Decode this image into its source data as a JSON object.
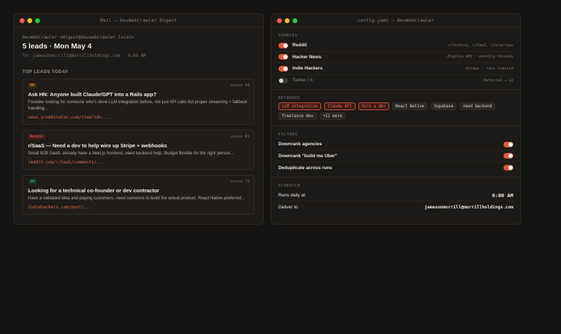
{
  "mail": {
    "window_title": "Mail — DevWebCrawler Digest",
    "from": "DevWebCrawler <digest@devwebcrawler.local>",
    "subject": "5 leads · Mon May 4",
    "to": "To: jamesonmorrill@morrillholdings.com · 6:00 AM",
    "section_label": "TOP LEADS TODAY",
    "leads": [
      {
        "tag": "HN",
        "score": "score 94",
        "title": "Ask HN: Anyone built Claude/GPT into a Rails app?",
        "snippet": "Founder looking for someone who's done LLM integration before, not just API calls but proper streaming + fallback handling...",
        "link": "news.ycombinator.com/item?id=..."
      },
      {
        "tag": "Reddit",
        "score": "score 81",
        "title": "r/SaaS — Need a dev to help wire up Stripe + webhooks",
        "snippet": "Small B2B SaaS, already have a Next.js frontend, need backend help. Budget flexible for the right person...",
        "link": "reddit.com/r/SaaS/comments/..."
      },
      {
        "tag": "IH",
        "score": "score 72",
        "title": "Looking for a technical co-founder or dev contractor",
        "snippet": "Have a validated idea and paying customers, need someone to build the actual product. React Native preferred...",
        "link": "indiehackers.com/post/..."
      }
    ]
  },
  "config": {
    "window_title": "config.yaml — DevWebCrawler",
    "sources_label": "SOURCES",
    "sources": [
      {
        "name": "Reddit",
        "detail": "r/forhire, r/SaaS, r/startups",
        "enabled": true
      },
      {
        "name": "Hacker News",
        "detail": "Algolia API · monthly threads",
        "enabled": true
      },
      {
        "name": "Indie Hackers",
        "detail": "Scrape · rate limited",
        "enabled": true
      },
      {
        "name": "Twitter / X",
        "detail": "Deferred → v2",
        "enabled": false
      }
    ],
    "keywords_label": "KEYWORDS",
    "keywords": [
      {
        "text": "LLM integration",
        "hot": true
      },
      {
        "text": "Claude API",
        "hot": true
      },
      {
        "text": "hire a dev",
        "hot": true
      },
      {
        "text": "React Native",
        "hot": false
      },
      {
        "text": "Supabase",
        "hot": false
      },
      {
        "text": "need backend",
        "hot": false
      },
      {
        "text": "freelance dev",
        "hot": false
      },
      {
        "text": "+12 more",
        "hot": false
      }
    ],
    "filters_label": "FILTERS",
    "filters": [
      {
        "name": "Downrank agencies",
        "enabled": true
      },
      {
        "name": "Downrank \"build me Uber\"",
        "enabled": true
      },
      {
        "name": "Deduplicate across runs",
        "enabled": true
      }
    ],
    "schedule_label": "SCHEDULE",
    "schedule": {
      "runs_label": "Runs daily at",
      "runs_value": "6:00 AM",
      "deliver_label": "Deliver to",
      "deliver_value": "jamesonmorrill@morrillholdings.com"
    }
  },
  "colors": {
    "accent": "#e0583a",
    "background": "#161412",
    "window": "#1c1a18"
  }
}
